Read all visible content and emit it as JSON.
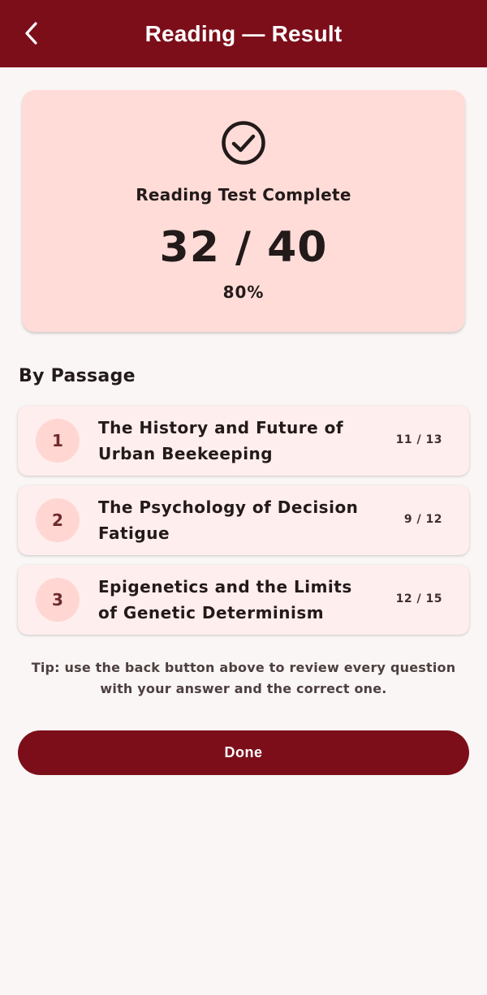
{
  "header": {
    "title": "Reading — Result",
    "back_icon": "chevron-left-icon"
  },
  "summary": {
    "icon": "check-circle-icon",
    "heading": "Reading Test Complete",
    "score": "32 / 40",
    "percent": "80%"
  },
  "passages": {
    "section_title": "By Passage",
    "items": [
      {
        "number": "1",
        "title_line1": "The History and Future of",
        "title_line2": "Urban Beekeeping",
        "score": "11 / 13"
      },
      {
        "number": "2",
        "title_line1": "The Psychology of Decision",
        "title_line2": "Fatigue",
        "score": "9 / 12"
      },
      {
        "number": "3",
        "title_line1": "Epigenetics and the Limits",
        "title_line2": "of Genetic Determinism",
        "score": "12 / 15"
      }
    ]
  },
  "tip": {
    "line1": "Tip: use the back button above to review every question",
    "line2": "with your answer and the correct one."
  },
  "actions": {
    "done_label": "Done"
  },
  "colors": {
    "primary": "#7c0e1a",
    "card_bg": "#ffdcd8",
    "passage_bg": "#ffeeed",
    "badge_bg": "#ffd6d2",
    "page_bg": "#faf6f6"
  }
}
